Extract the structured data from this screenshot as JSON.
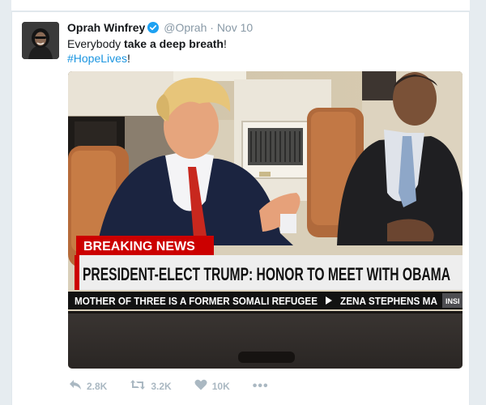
{
  "tweet": {
    "author_name": "Oprah Winfrey",
    "handle": "@Oprah",
    "separator": "·",
    "date": "Nov 10",
    "text_lead": "Everybody ",
    "text_bold": "take a deep breath",
    "text_tail": "!",
    "hashtag": "#HopeLives",
    "hashtag_tail": "!"
  },
  "media": {
    "breaking_label": "BREAKING NEWS",
    "headline": "PRESIDENT-ELECT TRUMP: HONOR TO MEET WITH OBAMA",
    "ticker_left": "MOTHER OF THREE IS A FORMER SOMALI REFUGEE",
    "ticker_right": "ZENA STEPHENS MA",
    "ticker_tag": "INSI"
  },
  "actions": {
    "reply_count": "2.8K",
    "retweet_count": "3.2K",
    "like_count": "10K",
    "more_label": "•••"
  },
  "colors": {
    "accent": "#1b95e0",
    "muted": "#8899a6",
    "action_gray": "#aab8c2",
    "breaking_red": "#cc0000"
  },
  "icons": [
    "verified-badge-icon",
    "reply-icon",
    "retweet-icon",
    "heart-icon",
    "more-icon"
  ]
}
